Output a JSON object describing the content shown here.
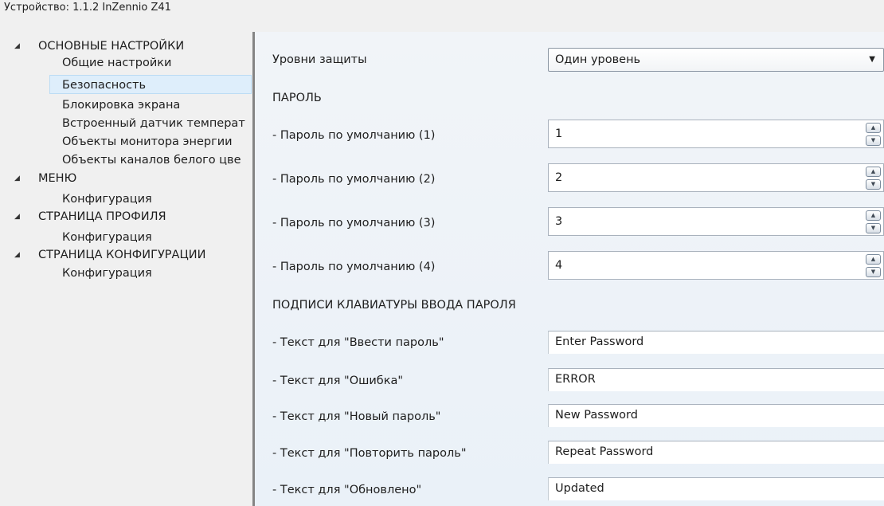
{
  "title": "Устройство: 1.1.2  InZennio Z41",
  "tree": {
    "groups": [
      {
        "label": "ОСНОВНЫЕ НАСТРОЙКИ",
        "items": [
          "Общие настройки",
          "Безопасность",
          "Блокировка экрана",
          "Встроенный датчик температ",
          "Объекты монитора энергии",
          "Объекты каналов белого цве"
        ]
      },
      {
        "label": "МЕНЮ",
        "items": [
          "Конфигурация"
        ]
      },
      {
        "label": "СТРАНИЦА ПРОФИЛЯ",
        "items": [
          "Конфигурация"
        ]
      },
      {
        "label": "СТРАНИЦА КОНФИГУРАЦИИ",
        "items": [
          "Конфигурация"
        ]
      }
    ],
    "selected": "Безопасность"
  },
  "form": {
    "protection_label": "Уровни защиты",
    "protection_value": "Один уровень",
    "password_header": "ПАРОЛЬ",
    "passwords": [
      {
        "label": " - Пароль по умолчанию (1)",
        "value": "1"
      },
      {
        "label": " - Пароль по умолчанию (2)",
        "value": "2"
      },
      {
        "label": " - Пароль по умолчанию (3)",
        "value": "3"
      },
      {
        "label": " - Пароль по умолчанию (4)",
        "value": "4"
      }
    ],
    "keyboard_header": "ПОДПИСИ КЛАВИАТУРЫ ВВОДА ПАРОЛЯ",
    "texts": [
      {
        "label": " - Текст для \"Ввести пароль\"",
        "value": "Enter Password"
      },
      {
        "label": " - Текст для \"Ошибка\"",
        "value": "ERROR"
      },
      {
        "label": " - Текст для \"Новый пароль\"",
        "value": "New Password"
      },
      {
        "label": " - Текст для \"Повторить пароль\"",
        "value": "Repeat Password"
      },
      {
        "label": " - Текст для \"Обновлено\"",
        "value": "Updated"
      }
    ]
  }
}
